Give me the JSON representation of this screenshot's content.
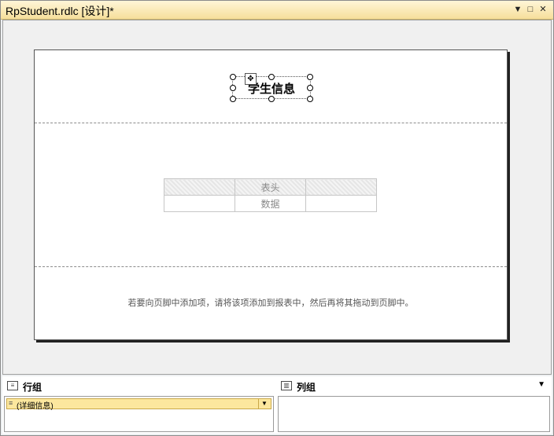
{
  "window": {
    "title": "RpStudent.rdlc [设计]*",
    "buttons": {
      "pin": "▼",
      "restore": "□",
      "close": "✕"
    }
  },
  "report": {
    "title_textbox": "学生信息",
    "table": {
      "header_cells": [
        "",
        "表头",
        ""
      ],
      "data_cells": [
        "",
        "数据",
        ""
      ]
    },
    "footer_hint": "若要向页脚中添加项，请将该项添加到报表中，然后再将其拖动到页脚中。"
  },
  "row_groups": {
    "label": "行组",
    "items": [
      "(详细信息)"
    ]
  },
  "column_groups": {
    "label": "列组"
  }
}
